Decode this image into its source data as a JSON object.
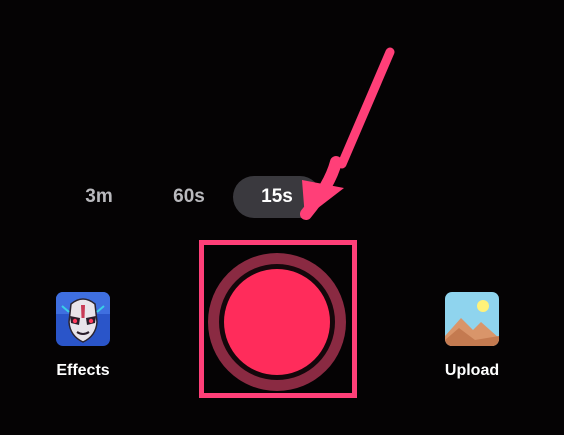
{
  "durations": [
    {
      "label": "3m",
      "selected": false
    },
    {
      "label": "60s",
      "selected": false
    },
    {
      "label": "15s",
      "selected": true
    }
  ],
  "record": {
    "label": "record",
    "color": "#ff2c5b",
    "highlight_color": "#ff3f78"
  },
  "effects": {
    "label": "Effects",
    "icon": "effects-mask-icon"
  },
  "upload": {
    "label": "Upload",
    "icon": "gallery-image-icon"
  },
  "annotation": {
    "icon": "arrow-pointer-icon",
    "color": "#ff3f78"
  }
}
